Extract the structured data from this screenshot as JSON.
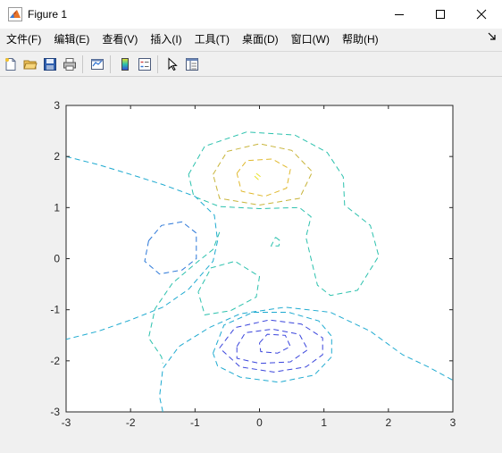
{
  "window": {
    "title": "Figure 1"
  },
  "menu": [
    {
      "id": "file",
      "label": "文件(F)"
    },
    {
      "id": "edit",
      "label": "编辑(E)"
    },
    {
      "id": "view",
      "label": "查看(V)"
    },
    {
      "id": "insert",
      "label": "插入(I)"
    },
    {
      "id": "tools",
      "label": "工具(T)"
    },
    {
      "id": "desktop",
      "label": "桌面(D)"
    },
    {
      "id": "window",
      "label": "窗口(W)"
    },
    {
      "id": "help",
      "label": "帮助(H)"
    }
  ],
  "toolbar": {
    "buttons": [
      "new-figure-icon",
      "open-file-icon",
      "save-icon",
      "print-icon",
      "link-plot-icon",
      "colorbar-icon",
      "legend-icon",
      "pointer-icon",
      "property-inspector-icon"
    ]
  },
  "chart_data": {
    "type": "contour",
    "line_style": "dashed",
    "title": "",
    "xlabel": "",
    "ylabel": "",
    "xlim": [
      -3,
      3
    ],
    "ylim": [
      -3,
      3
    ],
    "xticks": [
      -3,
      -2,
      -1,
      0,
      1,
      2,
      3
    ],
    "yticks": [
      3,
      2,
      1,
      0,
      -1,
      -2,
      -3
    ],
    "xtick_labels": [
      "-3",
      "-2",
      "-1",
      "0",
      "1",
      "2",
      "3"
    ],
    "ytick_labels": [
      "3",
      "2",
      "1",
      "0",
      "-1",
      "-2",
      "-3"
    ],
    "grid": false,
    "colors": {
      "yellow": "#e8e22a",
      "gold": "#e0b82c",
      "amber": "#c8b43a",
      "teal": "#2bc1ad",
      "cyan": "#1eaad0",
      "blue": "#2c78d8",
      "indigo": "#3a45dc"
    },
    "contours": [
      {
        "color": "yellow",
        "points": [
          [
            -0.05,
            1.67
          ],
          [
            0.02,
            1.6
          ],
          [
            -0.02,
            1.55
          ],
          [
            -0.08,
            1.62
          ],
          [
            -0.05,
            1.67
          ]
        ]
      },
      {
        "color": "gold",
        "points": [
          [
            -0.35,
            1.67
          ],
          [
            -0.2,
            1.92
          ],
          [
            0.2,
            1.95
          ],
          [
            0.48,
            1.75
          ],
          [
            0.42,
            1.38
          ],
          [
            0.08,
            1.22
          ],
          [
            -0.28,
            1.32
          ],
          [
            -0.35,
            1.67
          ]
        ]
      },
      {
        "color": "amber",
        "points": [
          [
            -0.72,
            1.65
          ],
          [
            -0.5,
            2.1
          ],
          [
            0,
            2.25
          ],
          [
            0.5,
            2.12
          ],
          [
            0.82,
            1.7
          ],
          [
            0.62,
            1.18
          ],
          [
            0,
            1.05
          ],
          [
            -0.62,
            1.18
          ],
          [
            -0.72,
            1.65
          ]
        ]
      },
      {
        "color": "teal",
        "points": [
          [
            -1.1,
            1.65
          ],
          [
            -0.85,
            2.2
          ],
          [
            -0.2,
            2.48
          ],
          [
            0.55,
            2.42
          ],
          [
            1.05,
            2.08
          ],
          [
            1.3,
            1.6
          ],
          [
            1.32,
            1.05
          ],
          [
            1.72,
            0.65
          ],
          [
            1.85,
            0.05
          ],
          [
            1.52,
            -0.62
          ],
          [
            1.1,
            -0.72
          ],
          [
            0.9,
            -0.52
          ],
          [
            0.8,
            0
          ],
          [
            0.72,
            0.42
          ],
          [
            0.8,
            0.82
          ],
          [
            0.62,
            1.0
          ],
          [
            0,
            0.98
          ],
          [
            -0.62,
            1.02
          ],
          [
            -1.02,
            1.22
          ],
          [
            -1.1,
            1.65
          ]
        ]
      },
      {
        "color": "teal",
        "points": [
          [
            0.25,
            0.42
          ],
          [
            0.32,
            0.35
          ],
          [
            0.3,
            0.25
          ],
          [
            0.18,
            0.25
          ],
          [
            0.25,
            0.42
          ]
        ]
      },
      {
        "color": "teal",
        "points": [
          [
            -0.95,
            -0.65
          ],
          [
            -0.75,
            -0.18
          ],
          [
            -0.38,
            -0.05
          ],
          [
            0,
            -0.35
          ],
          [
            -0.05,
            -0.75
          ],
          [
            -0.45,
            -1.02
          ],
          [
            -0.85,
            -1.1
          ],
          [
            -0.95,
            -0.65
          ]
        ]
      },
      {
        "color": "teal",
        "points": [
          [
            -0.62,
            0.52
          ],
          [
            -0.72,
            0.18
          ],
          [
            -0.95,
            -0.05
          ],
          [
            -1.35,
            -0.48
          ],
          [
            -1.62,
            -0.98
          ],
          [
            -1.72,
            -1.55
          ],
          [
            -1.52,
            -1.92
          ],
          [
            -1.5,
            -2.05
          ]
        ]
      },
      {
        "color": "cyan",
        "points": [
          [
            -3,
            2
          ],
          [
            -2.5,
            1.84
          ],
          [
            -2,
            1.65
          ],
          [
            -1.5,
            1.45
          ],
          [
            -1,
            1.22
          ],
          [
            -0.7,
            0.85
          ],
          [
            -0.65,
            0.35
          ],
          [
            -0.72,
            -0.05
          ],
          [
            -1.1,
            -0.6
          ],
          [
            -1.5,
            -0.95
          ],
          [
            -2,
            -1.2
          ],
          [
            -2.5,
            -1.42
          ],
          [
            -3,
            -1.58
          ]
        ]
      },
      {
        "color": "cyan",
        "points": [
          [
            -1.5,
            -3
          ],
          [
            -1.55,
            -2.7
          ],
          [
            -1.5,
            -2.15
          ],
          [
            -1.25,
            -1.72
          ],
          [
            -0.78,
            -1.35
          ],
          [
            -0.3,
            -1.08
          ],
          [
            0.4,
            -0.95
          ],
          [
            1.1,
            -1.05
          ],
          [
            1.72,
            -1.42
          ],
          [
            2.22,
            -1.88
          ],
          [
            2.62,
            -2.12
          ],
          [
            3,
            -2.38
          ]
        ]
      },
      {
        "color": "cyan",
        "points": [
          [
            -0.72,
            -1.85
          ],
          [
            -0.55,
            -1.3
          ],
          [
            -0.1,
            -1.05
          ],
          [
            0.45,
            -1.05
          ],
          [
            0.92,
            -1.22
          ],
          [
            1.12,
            -1.52
          ],
          [
            1.12,
            -1.92
          ],
          [
            0.85,
            -2.28
          ],
          [
            0.3,
            -2.42
          ],
          [
            -0.3,
            -2.32
          ],
          [
            -0.65,
            -2.1
          ],
          [
            -0.72,
            -1.85
          ]
        ]
      },
      {
        "color": "blue",
        "points": [
          [
            -1.72,
            0.35
          ],
          [
            -1.52,
            0.65
          ],
          [
            -1.2,
            0.72
          ],
          [
            -0.98,
            0.5
          ],
          [
            -0.98,
            0
          ],
          [
            -1.2,
            -0.22
          ],
          [
            -1.55,
            -0.3
          ],
          [
            -1.78,
            -0.05
          ],
          [
            -1.72,
            0.35
          ]
        ]
      },
      {
        "color": "indigo",
        "points": [
          [
            -0.62,
            -1.75
          ],
          [
            -0.38,
            -1.35
          ],
          [
            0.15,
            -1.2
          ],
          [
            0.65,
            -1.28
          ],
          [
            0.98,
            -1.55
          ],
          [
            0.98,
            -1.88
          ],
          [
            0.72,
            -2.12
          ],
          [
            0.22,
            -2.22
          ],
          [
            -0.3,
            -2.12
          ],
          [
            -0.62,
            -1.75
          ]
        ]
      },
      {
        "color": "indigo",
        "points": [
          [
            -0.35,
            -1.72
          ],
          [
            -0.22,
            -1.45
          ],
          [
            0.2,
            -1.38
          ],
          [
            0.62,
            -1.48
          ],
          [
            0.75,
            -1.78
          ],
          [
            0.48,
            -2.02
          ],
          [
            0,
            -2.05
          ],
          [
            -0.35,
            -1.95
          ],
          [
            -0.35,
            -1.72
          ]
        ]
      },
      {
        "color": "indigo",
        "points": [
          [
            0,
            -1.65
          ],
          [
            0.12,
            -1.48
          ],
          [
            0.4,
            -1.5
          ],
          [
            0.48,
            -1.72
          ],
          [
            0.28,
            -1.85
          ],
          [
            0.02,
            -1.82
          ],
          [
            0,
            -1.65
          ]
        ]
      }
    ]
  }
}
